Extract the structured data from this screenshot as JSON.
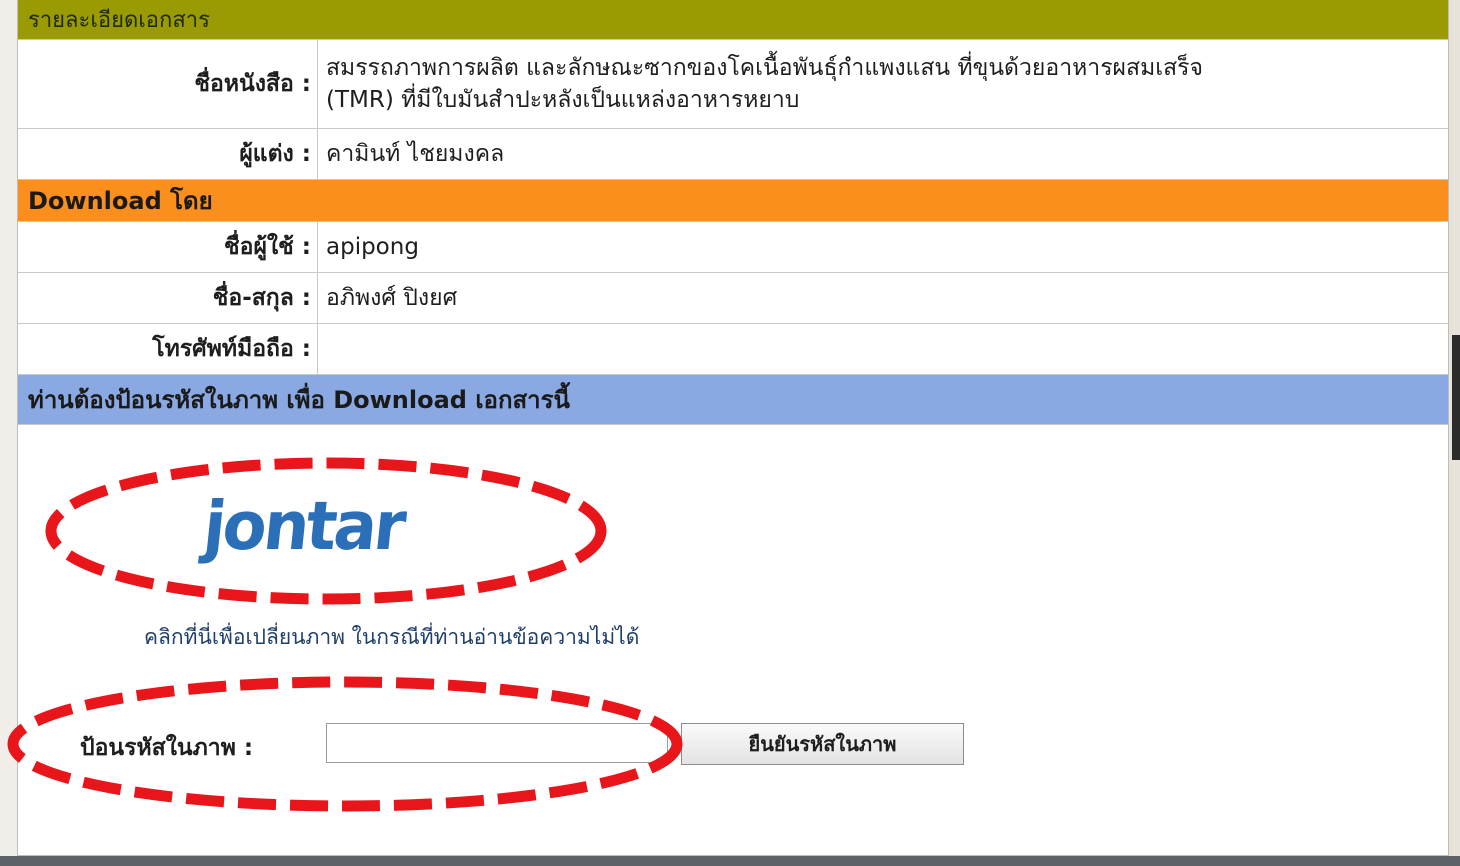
{
  "document_details": {
    "header": "รายละเอียดเอกสาร",
    "book_title_label": "ชื่อหนังสือ :",
    "book_title_value_line1": "สมรรถภาพการผลิต และลักษณะซากของโคเนื้อพันธุ์กำแพงแสน ที่ขุนด้วยอาหารผสมเสร็จ",
    "book_title_value_line2": "(TMR) ที่มีใบมันสำปะหลังเป็นแหล่งอาหารหยาบ",
    "author_label": "ผู้แต่ง :",
    "author_value": "คามินท์ ไชยมงคล"
  },
  "download_by": {
    "header": "Download โดย",
    "username_label": "ชื่อผู้ใช้ :",
    "username_value": "apipong",
    "fullname_label": "ชื่อ-สกุล :",
    "fullname_value": "อภิพงศ์ ปิงยศ",
    "mobile_label": "โทรศัพท์มือถือ :",
    "mobile_value": ""
  },
  "captcha": {
    "header": "ท่านต้องป้อนรหัสในภาพ เพื่อ Download เอกสารนี้",
    "image_text": "jontar",
    "refresh_link": "คลิกที่นี่เพื่อเปลี่ยนภาพ ในกรณีที่ท่านอ่านข้อความไม่ได้",
    "input_label": "ป้อนรหัสในภาพ :",
    "input_value": "",
    "confirm_button": "ยืนยันรหัสในภาพ"
  },
  "colors": {
    "header_olive": "#9a9a05",
    "header_orange": "#fb8f1e",
    "header_blue": "#8aa8e2",
    "annotation_red": "#e8161b",
    "captcha_blue": "#2a6fb7"
  }
}
